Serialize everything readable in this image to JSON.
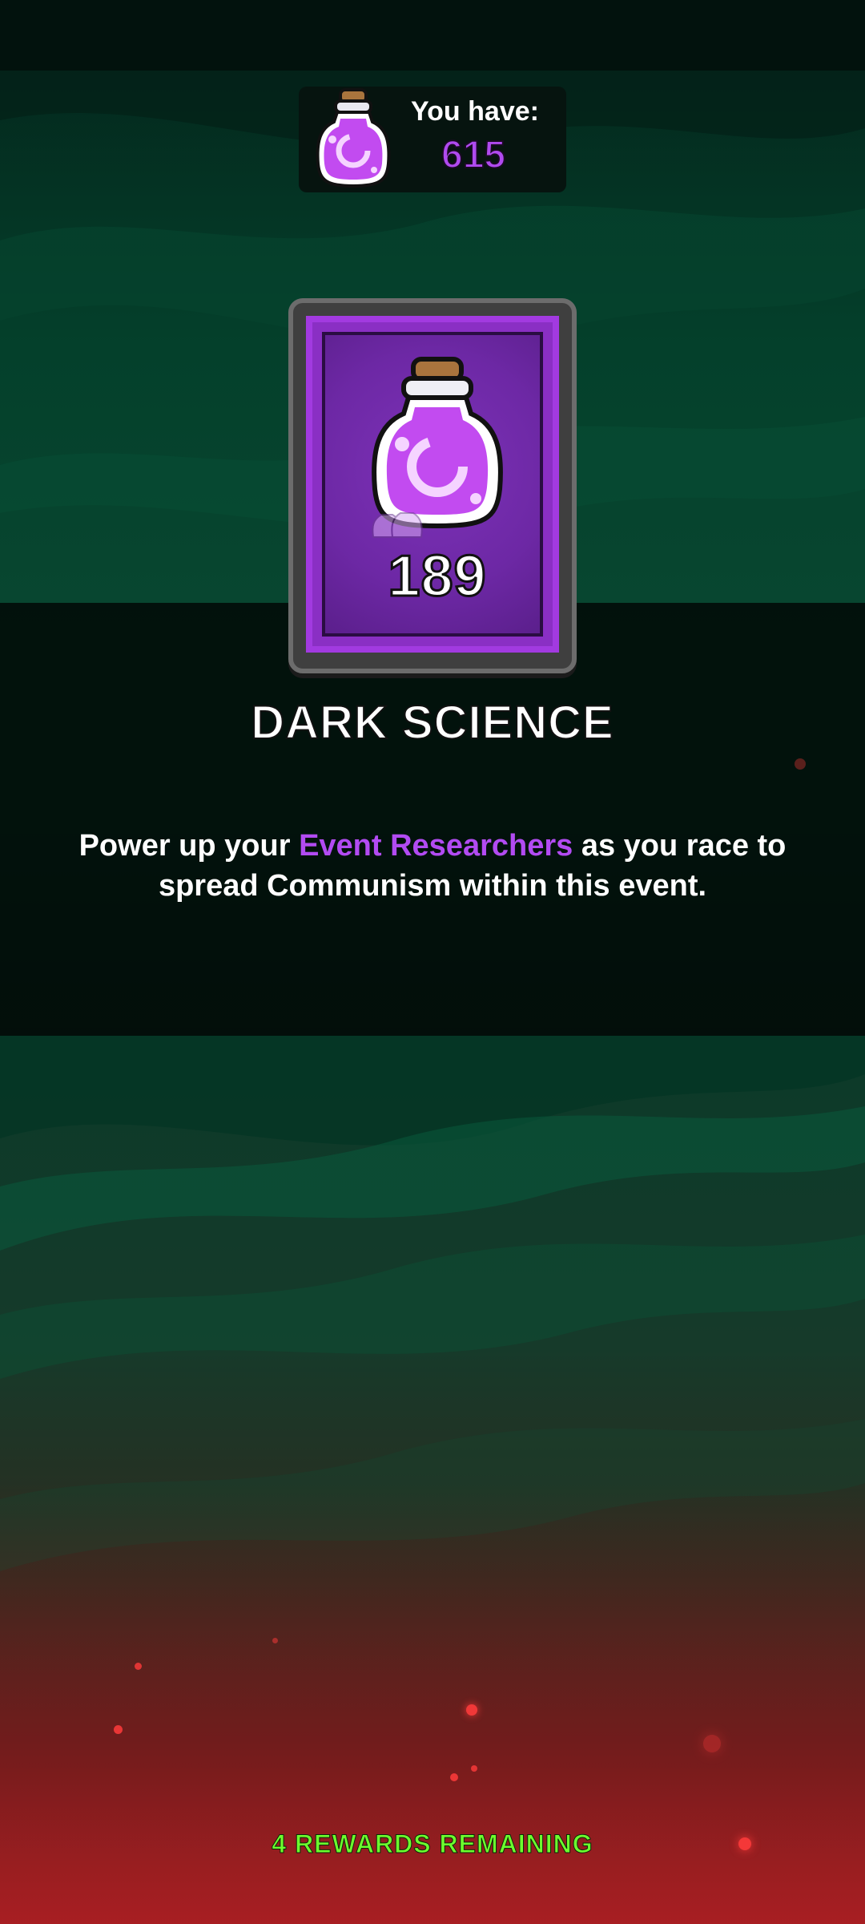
{
  "balance": {
    "label": "You have:",
    "value": "615",
    "icon": "potion-icon",
    "value_color": "#b04af0"
  },
  "reward": {
    "icon": "potion-icon",
    "amount": "189",
    "name": "DARK SCIENCE"
  },
  "description": {
    "before": "Power up your ",
    "highlight": "Event Researchers",
    "after": " as you race to spread Communism within this event.",
    "highlight_color": "#b24bf2"
  },
  "footer": {
    "remaining_label": "4 REWARDS REMAINING",
    "color": "#6dff2e"
  }
}
